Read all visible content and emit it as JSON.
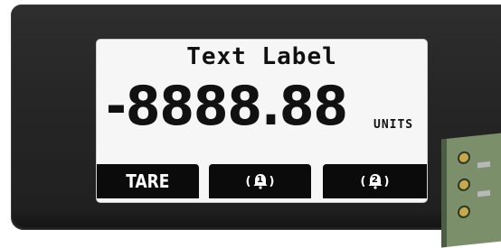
{
  "display": {
    "title": "Text Label",
    "value": "-8888.88",
    "units": "UNITS"
  },
  "softkeys": [
    {
      "label": "TARE",
      "icon": "tare"
    },
    {
      "label": "1",
      "icon": "alarm-bell-icon"
    },
    {
      "label": "2",
      "icon": "alarm-bell-icon"
    }
  ],
  "colors": {
    "bezel": "#262626",
    "lcd_background": "#f6f6f6",
    "text": "#111111",
    "softkey_background": "#0b0b0b",
    "softkey_text": "#ffffff",
    "board": "#7a8f6a"
  }
}
